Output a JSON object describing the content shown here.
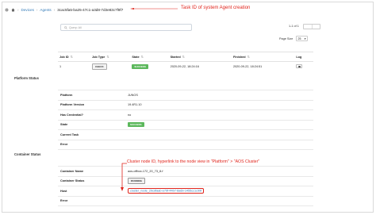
{
  "breadcrumb": {
    "devices": "Devices",
    "agents": "Agents",
    "agent_id": "3cac5fa5-ba25-47c1-a3d8-7d3e83c7f9f7",
    "sep": "›"
  },
  "annotations": {
    "task_id": "Task ID of system Agent creation",
    "cluster_node": "Cluster node ID, hyperlink to the node view in \"Platform\" > \"AOS Cluster\""
  },
  "search": {
    "placeholder": "Query: All"
  },
  "pagination": {
    "count": "1-1 of 1",
    "page_size_label": "Page Size",
    "page_size": "25"
  },
  "jobs_table": {
    "headers": [
      "Job ID",
      "Job Type",
      "State",
      "Started",
      "Finished",
      "Log"
    ],
    "rows": [
      {
        "id": "1",
        "type": "CHECK",
        "state": "SUCCESS",
        "started": "2020-09-22, 18:24:16",
        "finished": "2020-09-22, 18:24:51"
      }
    ]
  },
  "platform_status": {
    "title": "Platform Status",
    "rows": [
      {
        "label": "Platform",
        "value": "JUNOS"
      },
      {
        "label": "Platform Version",
        "value": "19.4R1.10"
      },
      {
        "label": "Has Credential?",
        "value": "no"
      },
      {
        "label": "State",
        "value": "SUCCESS"
      },
      {
        "label": "Current Task",
        "value": ""
      },
      {
        "label": "Error",
        "value": ""
      }
    ]
  },
  "container_status": {
    "title": "Container Status",
    "rows": [
      {
        "label": "Container Name",
        "value": "aos-offbox-172_20_73_8-f"
      },
      {
        "label": "Container Status",
        "value": "RUNNING"
      },
      {
        "label": "Host",
        "value": "cluster_node_29cdfaab-e79f-44b7-8a6b-1455cc1c99f"
      },
      {
        "label": "Error",
        "value": ""
      }
    ]
  },
  "colors": {
    "accent": "#337ab7",
    "success": "#5cb85c",
    "annotation": "#e0241b"
  }
}
